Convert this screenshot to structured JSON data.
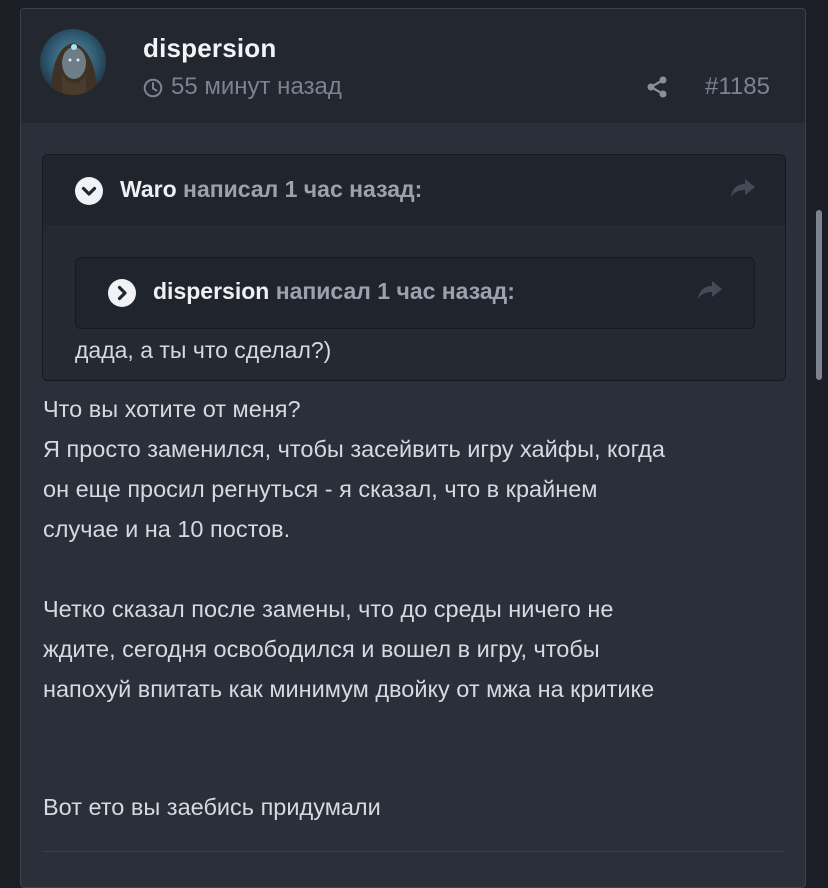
{
  "post": {
    "author": "dispersion",
    "time": "55 минут назад",
    "number": "#1185"
  },
  "quote": {
    "author": "Waro",
    "meta": " написал 1 час назад:",
    "nested": {
      "author": "dispersion",
      "meta": " написал 1 час назад:"
    },
    "text": "дада, а ты что сделал?)"
  },
  "body": {
    "lines": [
      "Что вы хотите от меня?",
      "Я просто заменился, чтобы засейвить игру хайфы, когда",
      "он еще просил регнуться - я сказал, что в крайнем",
      "случае и на 10 постов.",
      "Четко сказал после замены, что до среды ничего не",
      "ждите, сегодня освободился и вошел в игру, чтобы",
      "напохуй впитать как минимум двойку от мжа на критике",
      "Вот ето вы заебись придумали"
    ]
  },
  "icons": {
    "clock": "clock-icon",
    "share": "share-icon",
    "reply": "reply-arrow-icon",
    "collapse": "chevron-down-icon",
    "expand": "chevron-right-icon"
  }
}
